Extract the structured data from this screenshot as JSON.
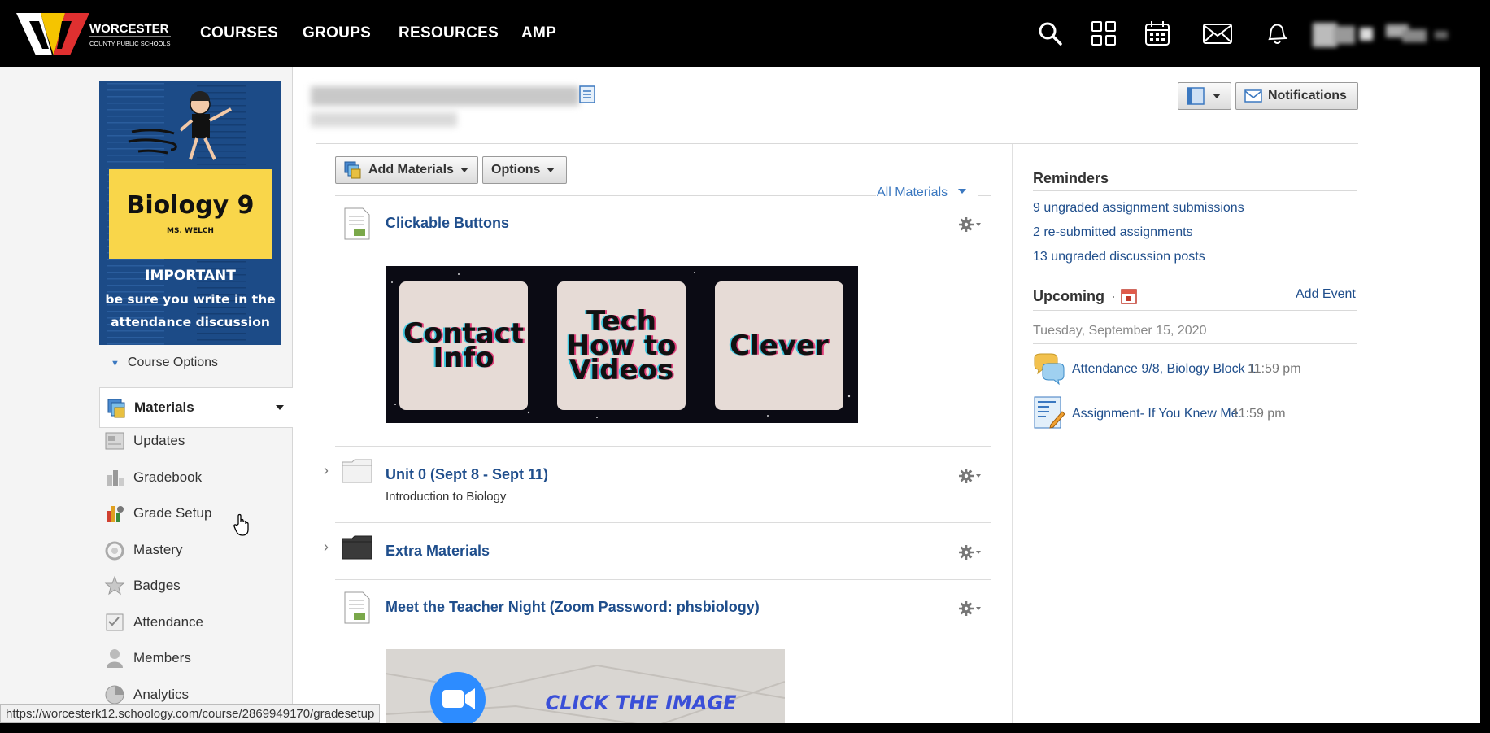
{
  "brand": {
    "logo_main": "WORCESTER",
    "logo_sub": "COUNTY PUBLIC SCHOOLS"
  },
  "nav": {
    "links": [
      "COURSES",
      "GROUPS",
      "RESOURCES",
      "AMP"
    ],
    "icons": [
      "search-icon",
      "apps-grid-icon",
      "calendar-icon",
      "mail-icon",
      "bell-icon"
    ]
  },
  "sidebar": {
    "banner": {
      "title": "Biology 9",
      "teacher": "MS. WELCH",
      "important": "IMPORTANT",
      "message_line1": "be sure you write in the",
      "message_line2": "attendance discussion"
    },
    "course_options": "Course Options",
    "selected": "Materials",
    "items": [
      "Updates",
      "Gradebook",
      "Grade Setup",
      "Mastery",
      "Badges",
      "Attendance",
      "Members",
      "Analytics"
    ]
  },
  "toolbar": {
    "add_materials": "Add Materials",
    "options": "Options",
    "all_materials": "All Materials",
    "notifications": "Notifications"
  },
  "materials": [
    {
      "title": "Clickable Buttons",
      "tiles": [
        "Contact Info",
        "Tech How to Videos",
        "Clever"
      ]
    },
    {
      "title": "Unit 0 (Sept 8 - Sept 11)",
      "subtitle": "Introduction to Biology"
    },
    {
      "title": "Extra Materials"
    },
    {
      "title": "Meet the Teacher Night (Zoom Password: phsbiology)",
      "image_text": "CLICK THE IMAGE"
    }
  ],
  "reminders": {
    "heading": "Reminders",
    "items": [
      "9 ungraded assignment submissions",
      "2 re-submitted assignments",
      "13 ungraded discussion posts"
    ]
  },
  "upcoming": {
    "heading": "Upcoming",
    "sep": "·",
    "add_event": "Add Event",
    "date": "Tuesday, September 15, 2020",
    "events": [
      {
        "title": "Attendance 9/8, Biology Block 1",
        "time": "11:59 pm"
      },
      {
        "title": "Assignment- If You Knew Me...",
        "time": "11:59 pm"
      }
    ]
  },
  "statusbar": {
    "url": "https://worcesterk12.schoology.com/course/2869949170/gradesetup"
  }
}
